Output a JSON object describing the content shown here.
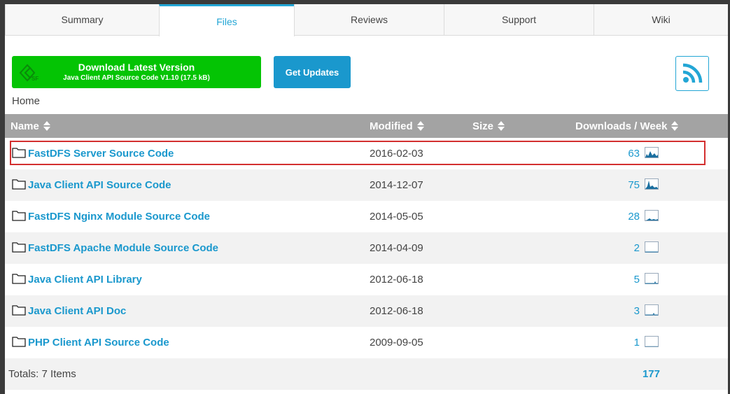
{
  "tabs": [
    "Summary",
    "Files",
    "Reviews",
    "Support",
    "Wiki"
  ],
  "active_tab": "Files",
  "download": {
    "title": "Download Latest Version",
    "subtitle": "Java Client API Source Code V1.10 (17.5 kB)"
  },
  "updates_label": "Get Updates",
  "rss_icon": "rss-icon",
  "breadcrumb": "Home",
  "columns": {
    "name": "Name",
    "modified": "Modified",
    "size": "Size",
    "downloads": "Downloads / Week"
  },
  "rows": [
    {
      "name": "FastDFS Server Source Code",
      "modified": "2016-02-03",
      "downloads": "63"
    },
    {
      "name": "Java Client API Source Code",
      "modified": "2014-12-07",
      "downloads": "75"
    },
    {
      "name": "FastDFS Nginx Module Source Code",
      "modified": "2014-05-05",
      "downloads": "28"
    },
    {
      "name": "FastDFS Apache Module Source Code",
      "modified": "2014-04-09",
      "downloads": "2"
    },
    {
      "name": "Java Client API Library",
      "modified": "2012-06-18",
      "downloads": "5"
    },
    {
      "name": "Java Client API Doc",
      "modified": "2012-06-18",
      "downloads": "3"
    },
    {
      "name": "PHP Client API Source Code",
      "modified": "2009-09-05",
      "downloads": "1"
    }
  ],
  "totals": {
    "label": "Totals: 7 Items",
    "downloads": "177"
  },
  "colors": {
    "accent": "#23a6d5",
    "link": "#1a98cd",
    "download_button": "#04c404",
    "header": "#a3a3a3",
    "highlight": "#d32f2f"
  }
}
